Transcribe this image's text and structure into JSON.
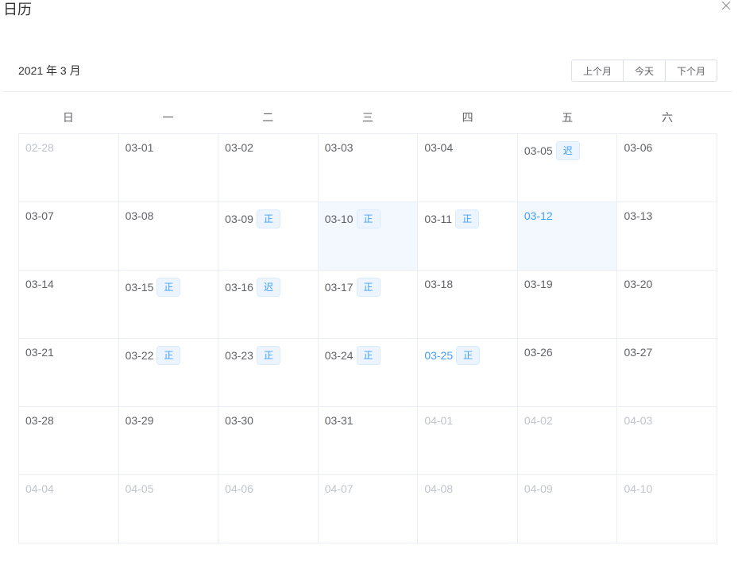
{
  "dialog": {
    "title": "日历"
  },
  "calendar": {
    "month_label": "2021 年 3 月",
    "buttons": {
      "prev": "上个月",
      "today": "今天",
      "next": "下个月"
    },
    "weekdays": [
      "日",
      "一",
      "二",
      "三",
      "四",
      "五",
      "六"
    ],
    "weeks": [
      [
        {
          "date": "02-28",
          "other": true
        },
        {
          "date": "03-01"
        },
        {
          "date": "03-02"
        },
        {
          "date": "03-03"
        },
        {
          "date": "03-04"
        },
        {
          "date": "03-05",
          "tag": "迟"
        },
        {
          "date": "03-06"
        }
      ],
      [
        {
          "date": "03-07"
        },
        {
          "date": "03-08"
        },
        {
          "date": "03-09",
          "tag": "正"
        },
        {
          "date": "03-10",
          "tag": "正",
          "selected": true
        },
        {
          "date": "03-11",
          "tag": "正"
        },
        {
          "date": "03-12",
          "selected": true,
          "highlight": true
        },
        {
          "date": "03-13"
        }
      ],
      [
        {
          "date": "03-14"
        },
        {
          "date": "03-15",
          "tag": "正"
        },
        {
          "date": "03-16",
          "tag": "迟"
        },
        {
          "date": "03-17",
          "tag": "正"
        },
        {
          "date": "03-18"
        },
        {
          "date": "03-19"
        },
        {
          "date": "03-20"
        }
      ],
      [
        {
          "date": "03-21"
        },
        {
          "date": "03-22",
          "tag": "正"
        },
        {
          "date": "03-23",
          "tag": "正"
        },
        {
          "date": "03-24",
          "tag": "正"
        },
        {
          "date": "03-25",
          "tag": "正",
          "highlight": true
        },
        {
          "date": "03-26"
        },
        {
          "date": "03-27"
        }
      ],
      [
        {
          "date": "03-28"
        },
        {
          "date": "03-29"
        },
        {
          "date": "03-30"
        },
        {
          "date": "03-31"
        },
        {
          "date": "04-01",
          "other": true
        },
        {
          "date": "04-02",
          "other": true
        },
        {
          "date": "04-03",
          "other": true
        }
      ],
      [
        {
          "date": "04-04",
          "other": true
        },
        {
          "date": "04-05",
          "other": true
        },
        {
          "date": "04-06",
          "other": true
        },
        {
          "date": "04-07",
          "other": true
        },
        {
          "date": "04-08",
          "other": true
        },
        {
          "date": "04-09",
          "other": true
        },
        {
          "date": "04-10",
          "other": true
        }
      ]
    ]
  },
  "colors": {
    "accent": "#409eff",
    "selected_bg": "#f2f8fe",
    "muted_text": "#c0c4cc",
    "border": "#ebeef5"
  },
  "icons": {
    "close": "close-icon"
  }
}
